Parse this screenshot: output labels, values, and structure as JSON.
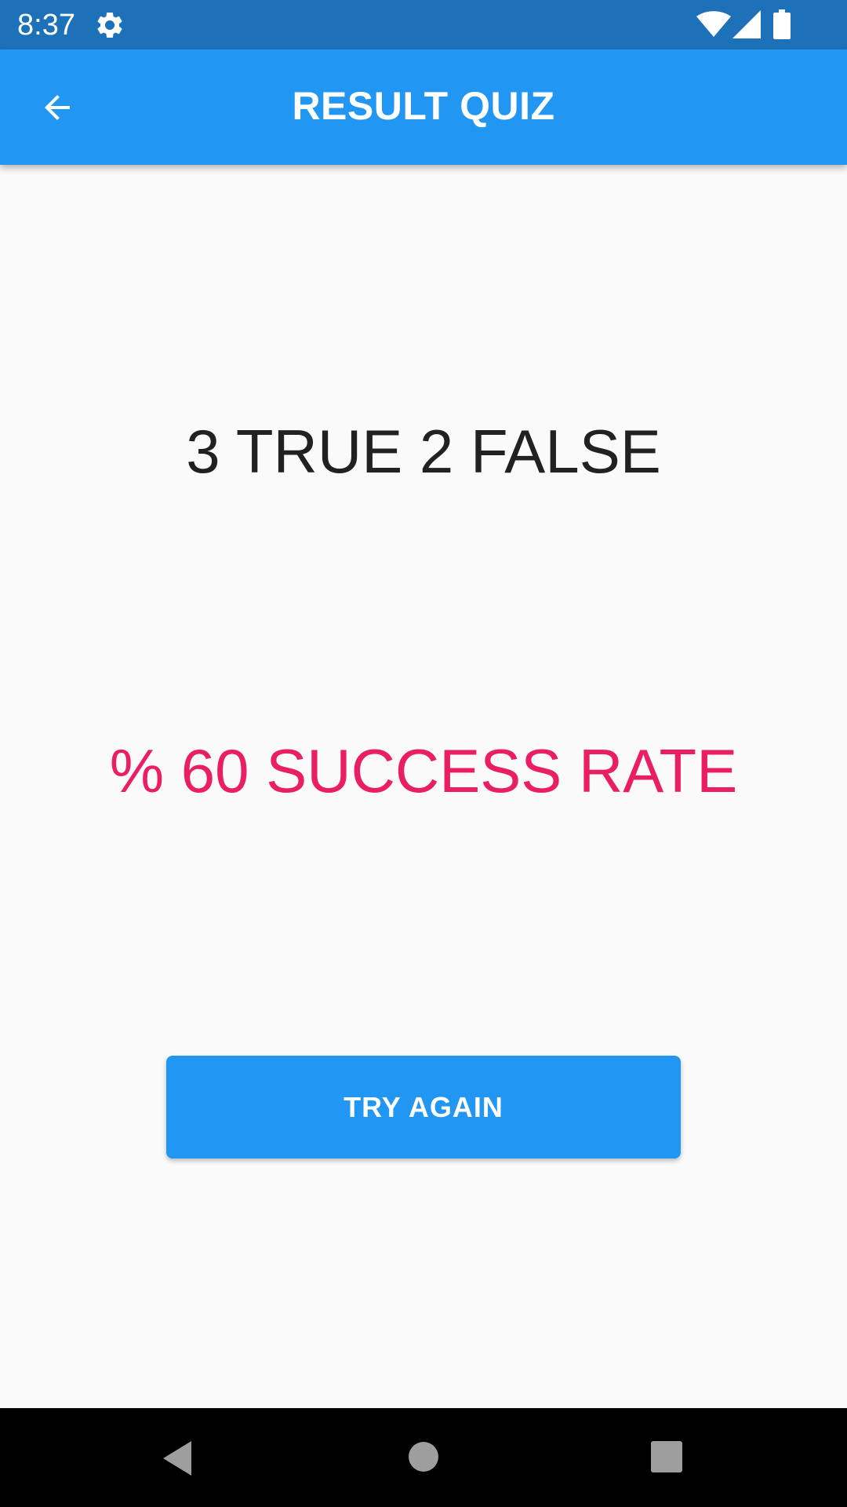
{
  "status_bar": {
    "time": "8:37",
    "icons": [
      "gear-icon",
      "wifi-icon",
      "signal-icon",
      "battery-icon"
    ],
    "background": "#1c71b8"
  },
  "app_bar": {
    "title": "RESULT QUIZ",
    "back_icon": "arrow-back-icon",
    "background": "#2196f3"
  },
  "result": {
    "score": "3 TRUE 2 FALSE",
    "rate": "% 60 SUCCESS RATE",
    "rate_color": "#e91e63"
  },
  "actions": {
    "try_again_label": "TRY AGAIN"
  },
  "nav_bar": {
    "icons": [
      "nav-back-icon",
      "nav-home-icon",
      "nav-recents-icon"
    ]
  }
}
